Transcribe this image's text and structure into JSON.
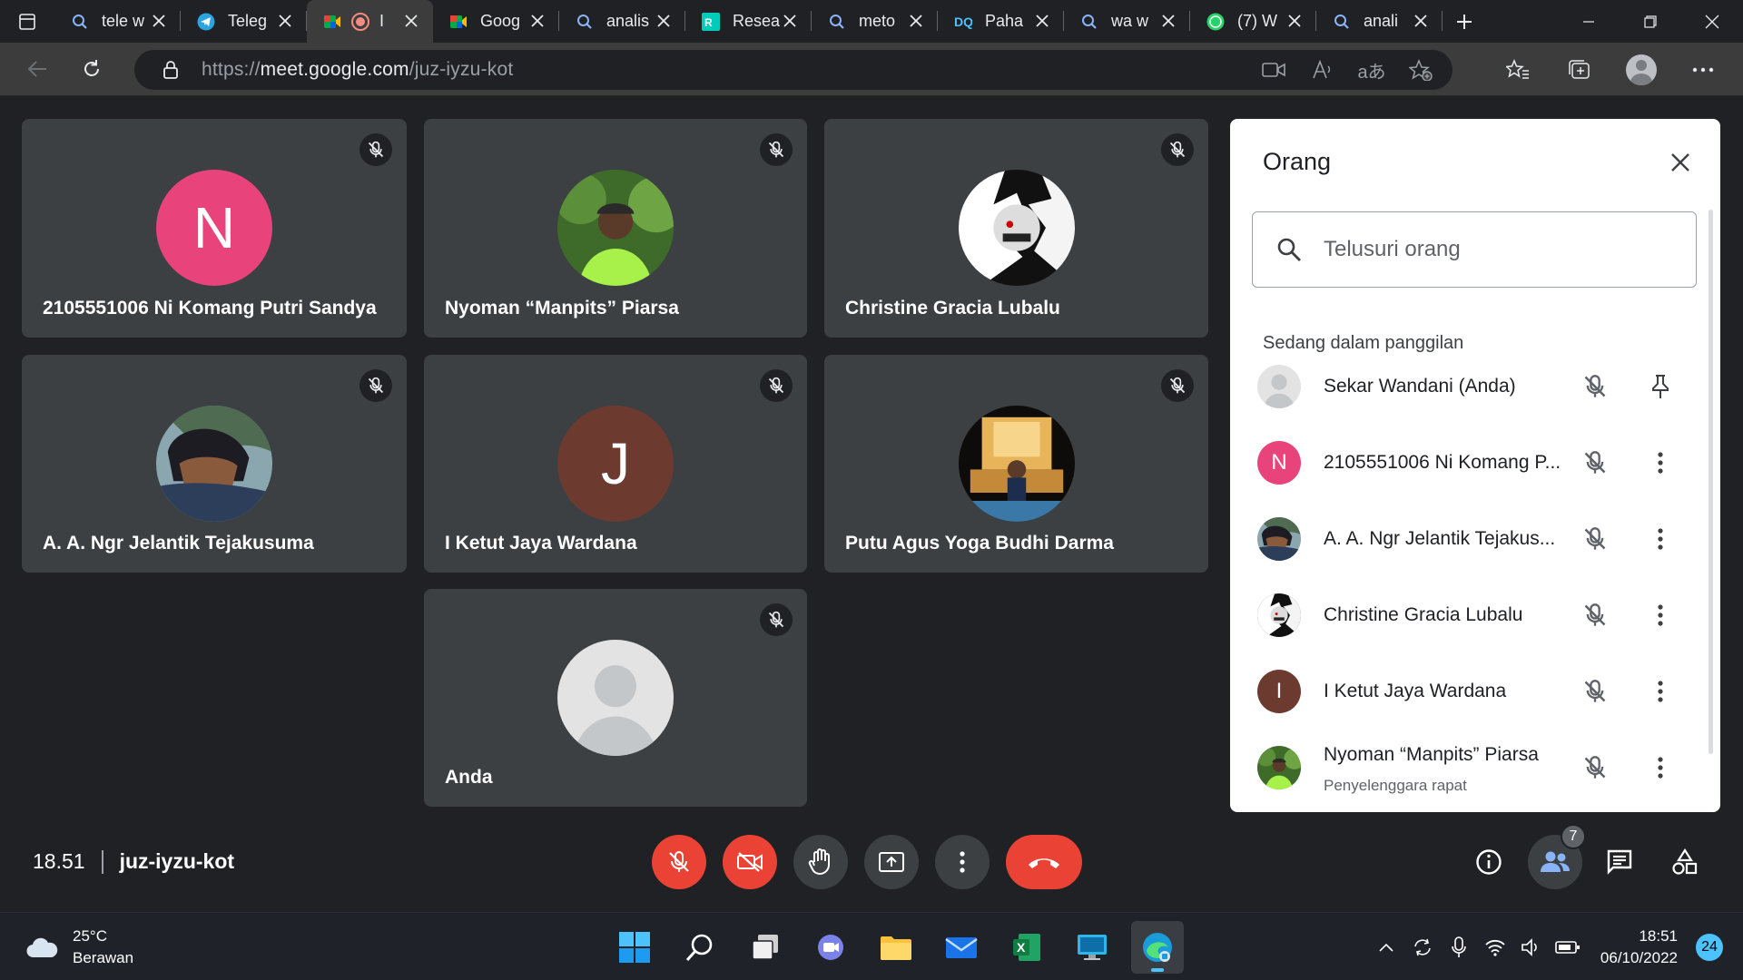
{
  "browser": {
    "tabs": [
      {
        "title": "tele w",
        "icon": "search-icon"
      },
      {
        "title": "Teleg",
        "icon": "telegram-icon"
      },
      {
        "title": "I",
        "icon": "meet-icon"
      },
      {
        "title": "Goog",
        "icon": "meet-icon"
      },
      {
        "title": "analis",
        "icon": "search-icon"
      },
      {
        "title": "Resea",
        "icon": "researchgate-icon"
      },
      {
        "title": "meto",
        "icon": "search-icon"
      },
      {
        "title": "Paha",
        "icon": "dq-icon"
      },
      {
        "title": "wa w",
        "icon": "search-icon"
      },
      {
        "title": "(7) W",
        "icon": "whatsapp-icon"
      },
      {
        "title": "anali",
        "icon": "search-icon"
      }
    ],
    "url_prefix": "https://",
    "url_host": "meet.google.com",
    "url_path": "/juz-iyzu-kot"
  },
  "tiles": [
    {
      "name": "2105551006 Ni Komang Putri Sandya",
      "initial": "N",
      "color": "#e8437a",
      "type": "initial"
    },
    {
      "name": "Nyoman “Manpits” Piarsa",
      "type": "photo-green"
    },
    {
      "name": "Christine Gracia Lubalu",
      "type": "photo-bw"
    },
    {
      "name": "A. A. Ngr Jelantik Tejakusuma",
      "type": "photo-dark"
    },
    {
      "name": "I Ketut Jaya Wardana",
      "initial": "J",
      "color": "#6d3a2f",
      "type": "initial"
    },
    {
      "name": "Putu Agus Yoga Budhi Darma",
      "type": "photo-night"
    },
    {
      "name": "Anda",
      "type": "default"
    }
  ],
  "panel": {
    "title": "Orang",
    "search_placeholder": "Telusuri orang",
    "section": "Sedang dalam panggilan",
    "people": [
      {
        "name": "Sekar Wandani (Anda)",
        "sub": "",
        "type": "default",
        "action": "pin-icon"
      },
      {
        "name": "2105551006 Ni Komang P...",
        "sub": "",
        "type": "initial",
        "initial": "N",
        "color": "#e8437a",
        "action": "more-vert-icon"
      },
      {
        "name": "A. A. Ngr Jelantik Tejakus...",
        "sub": "",
        "type": "photo-dark",
        "action": "more-vert-icon"
      },
      {
        "name": "Christine Gracia Lubalu",
        "sub": "",
        "type": "photo-bw",
        "action": "more-vert-icon"
      },
      {
        "name": "I Ketut Jaya Wardana",
        "sub": "",
        "type": "initial",
        "initial": "I",
        "color": "#6d3a2f",
        "action": "more-vert-icon"
      },
      {
        "name": "Nyoman “Manpits” Piarsa",
        "sub": "Penyelenggara rapat",
        "type": "photo-green",
        "action": "more-vert-icon"
      }
    ]
  },
  "meeting": {
    "time": "18.51",
    "code": "juz-iyzu-kot",
    "participant_count": "7"
  },
  "taskbar": {
    "temperature": "25°C",
    "weather": "Berawan",
    "time": "18:51",
    "date": "06/10/2022",
    "notifications": "24"
  }
}
